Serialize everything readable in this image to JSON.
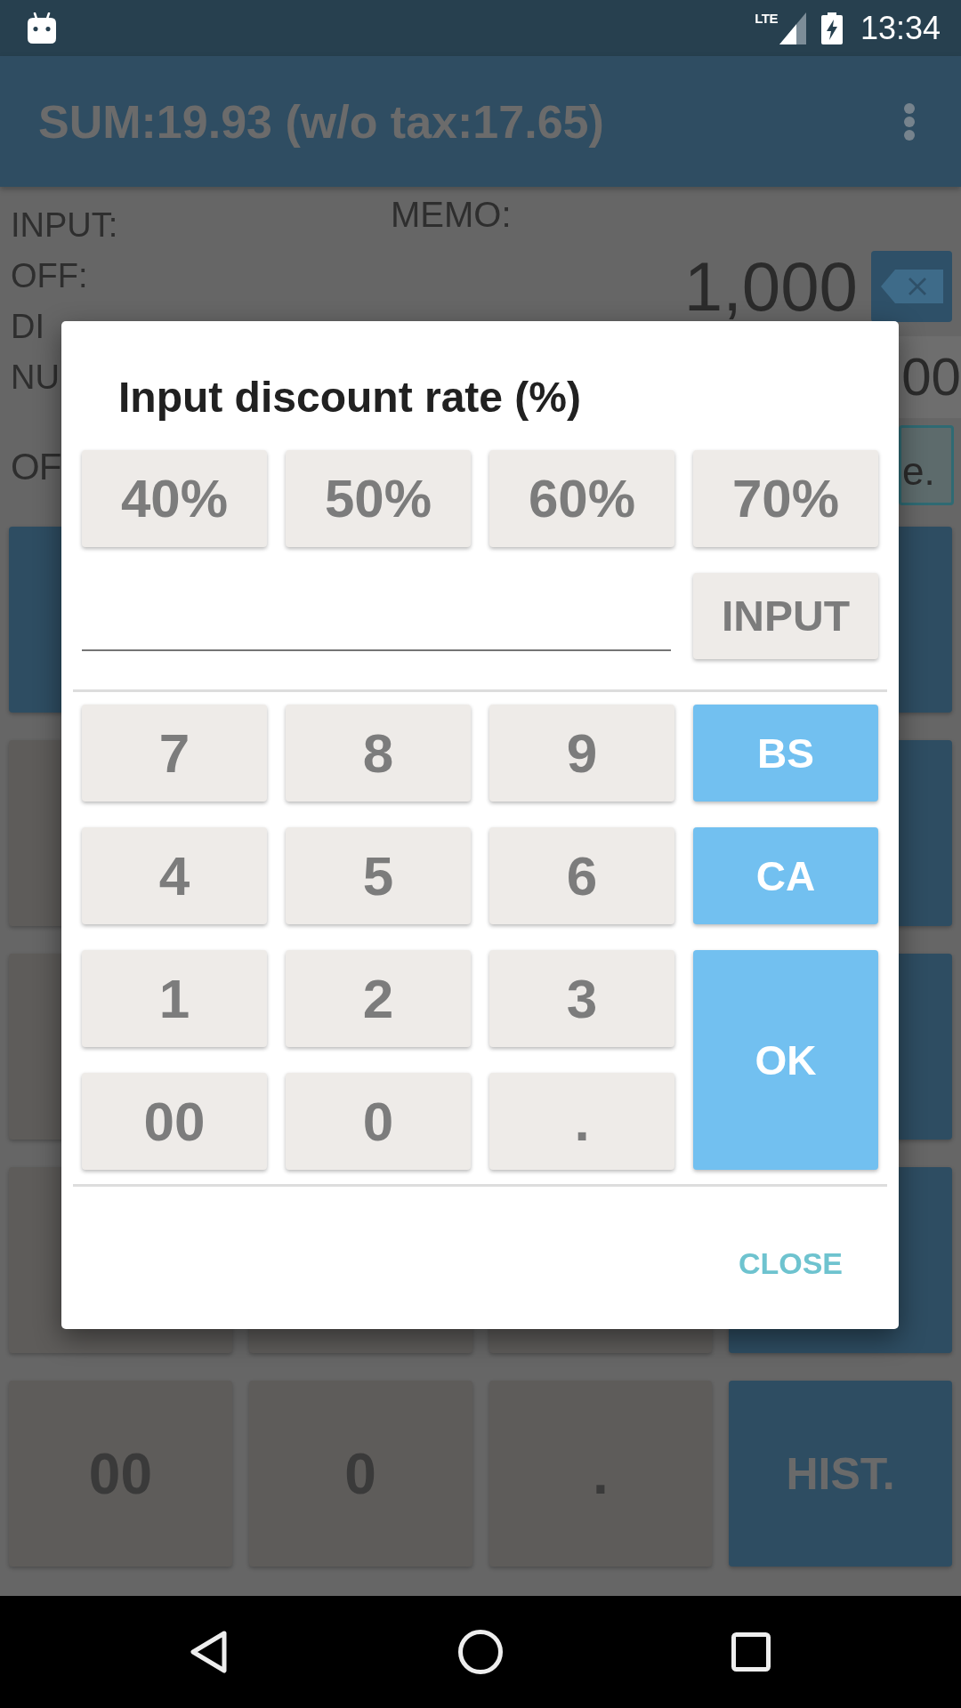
{
  "status_bar": {
    "network": "LTE",
    "time": "13:34"
  },
  "app_bar": {
    "title": "SUM:19.93 (w/o tax:17.65)"
  },
  "calculator": {
    "labels": [
      "INPUT:",
      "OFF:",
      "DI",
      "NU"
    ],
    "memo_label": "MEMO:",
    "amount": "1,000",
    "display_value": "00",
    "side_label": "OF",
    "side_button": "e.",
    "key_rows": [
      [
        {
          "kind": "function"
        },
        {
          "kind": "function"
        }
      ],
      [
        {
          "kind": "digit"
        },
        {
          "kind": "function"
        }
      ],
      [
        {
          "kind": "digit"
        },
        {
          "kind": "function"
        }
      ],
      [
        {
          "kind": "digit"
        },
        {
          "kind": "digit"
        },
        {
          "kind": "digit"
        },
        {
          "kind": "function"
        }
      ],
      [
        {
          "kind": "digit",
          "label": "00"
        },
        {
          "kind": "digit",
          "label": "0"
        },
        {
          "kind": "digit",
          "label": "."
        },
        {
          "kind": "function",
          "label": "HIST."
        }
      ]
    ]
  },
  "dialog": {
    "title": "Input discount rate (%)",
    "presets": [
      "40%",
      "50%",
      "60%",
      "70%"
    ],
    "input_button": "INPUT",
    "keys": [
      {
        "label": "7",
        "kind": "digit"
      },
      {
        "label": "8",
        "kind": "digit"
      },
      {
        "label": "9",
        "kind": "digit"
      },
      {
        "label": "BS",
        "kind": "action"
      },
      {
        "label": "4",
        "kind": "digit"
      },
      {
        "label": "5",
        "kind": "digit"
      },
      {
        "label": "6",
        "kind": "digit"
      },
      {
        "label": "CA",
        "kind": "action"
      },
      {
        "label": "1",
        "kind": "digit"
      },
      {
        "label": "2",
        "kind": "digit"
      },
      {
        "label": "3",
        "kind": "digit"
      },
      {
        "label": "OK",
        "kind": "tall"
      },
      {
        "label": "00",
        "kind": "digit"
      },
      {
        "label": "0",
        "kind": "digit"
      },
      {
        "label": ".",
        "kind": "digit"
      }
    ],
    "close_button": "CLOSE"
  }
}
